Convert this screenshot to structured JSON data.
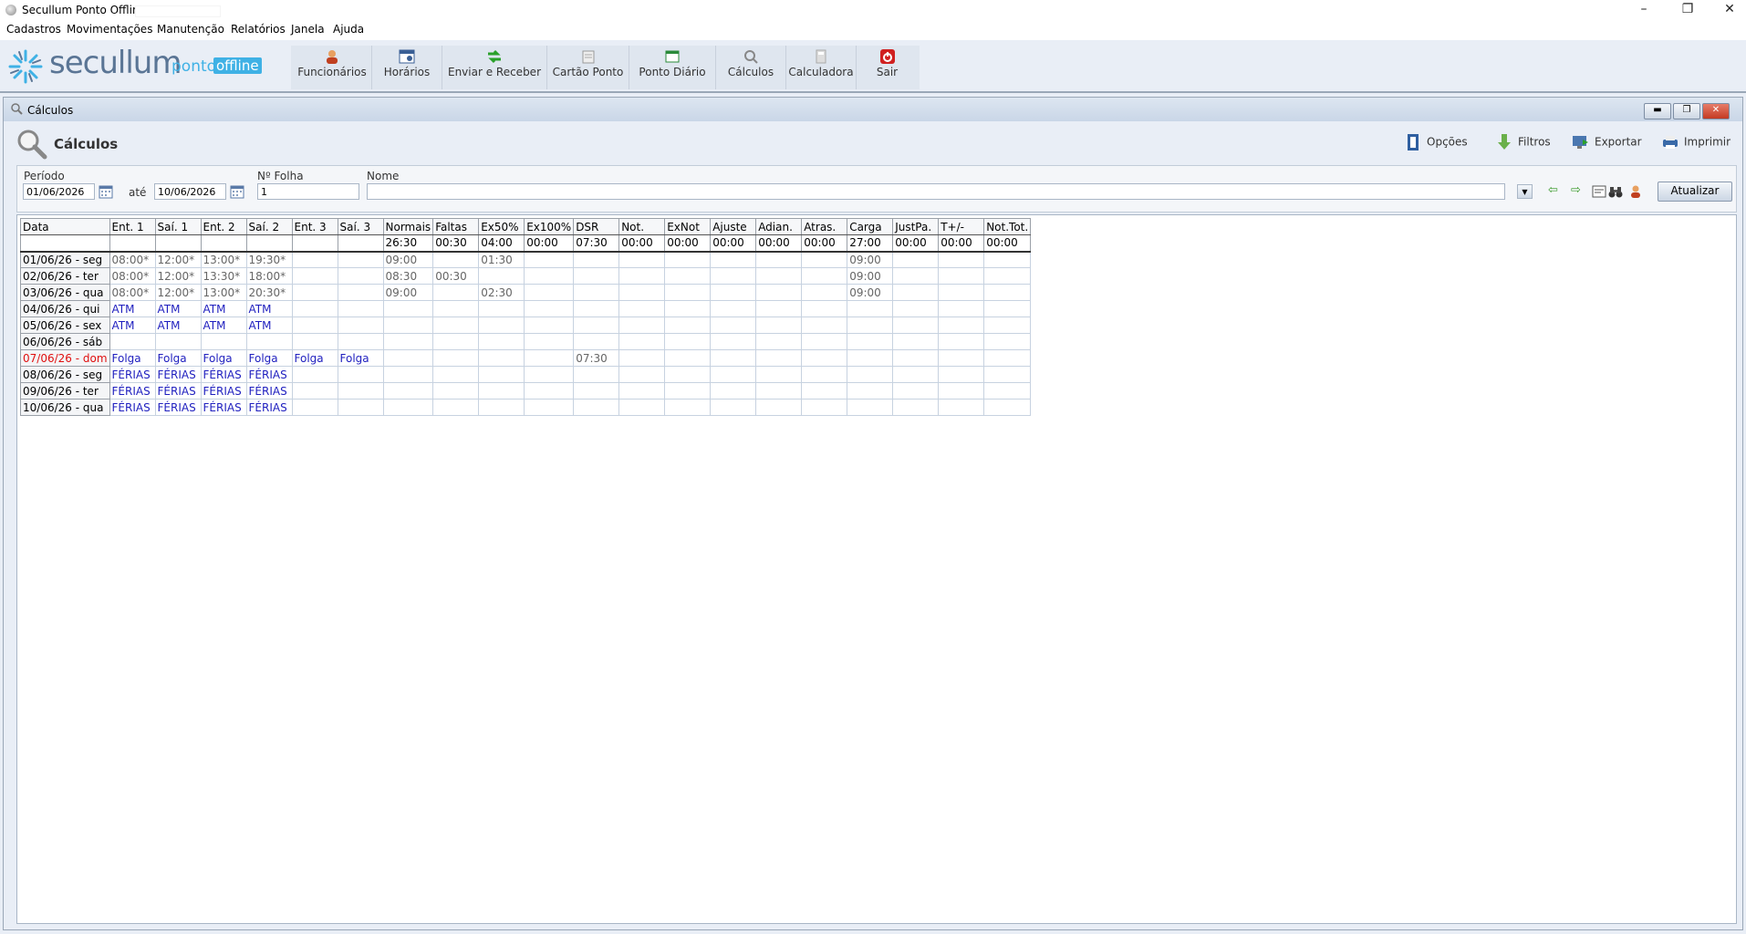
{
  "window": {
    "title": "Secullum Ponto Offline"
  },
  "menu": [
    "Cadastros",
    "Movimentações",
    "Manutenção",
    "Relatórios",
    "Janela",
    "Ajuda"
  ],
  "logo": {
    "word": "secullum",
    "ponto": "ponto",
    "offline": "offline"
  },
  "toolbar": [
    {
      "label": "Funcionários",
      "icon": "employee-icon"
    },
    {
      "label": "Horários",
      "icon": "schedule-icon"
    },
    {
      "label": "Enviar e Receber",
      "icon": "send-receive-icon"
    },
    {
      "label": "Cartão Ponto",
      "icon": "timecard-icon"
    },
    {
      "label": "Ponto Diário",
      "icon": "daily-icon"
    },
    {
      "label": "Cálculos",
      "icon": "calculations-icon"
    },
    {
      "label": "Calculadora",
      "icon": "calculator-icon"
    },
    {
      "label": "Sair",
      "icon": "exit-icon"
    }
  ],
  "inner": {
    "title": "Cálculos",
    "header": "Cálculos"
  },
  "actions": {
    "options": "Opções",
    "filters": "Filtros",
    "export": "Exportar",
    "print": "Imprimir"
  },
  "filter": {
    "period_label": "Período",
    "from": "01/06/2026",
    "until_label": "até",
    "to": "10/06/2026",
    "sheet_label": "Nº Folha",
    "sheet": "1",
    "name_label": "Nome",
    "name": "",
    "refresh": "Atualizar"
  },
  "grid": {
    "columns": [
      "Data",
      "Ent. 1",
      "Saí. 1",
      "Ent. 2",
      "Saí. 2",
      "Ent. 3",
      "Saí. 3",
      "Normais",
      "Faltas",
      "Ex50%",
      "Ex100%",
      "DSR",
      "Not.",
      "ExNot",
      "Ajuste",
      "Adian.",
      "Atras.",
      "Carga",
      "JustPa.",
      "T+/-",
      "Not.Tot."
    ],
    "totals": [
      "",
      "",
      "",
      "",
      "",
      "",
      "",
      "26:30",
      "00:30",
      "04:00",
      "00:00",
      "07:30",
      "00:00",
      "00:00",
      "00:00",
      "00:00",
      "00:00",
      "27:00",
      "00:00",
      "00:00",
      "00:00"
    ],
    "rows": [
      {
        "style": "gray",
        "cells": [
          "01/06/26 - seg",
          "08:00*",
          "12:00*",
          "13:00*",
          "19:30*",
          "",
          "",
          "09:00",
          "",
          "01:30",
          "",
          "",
          "",
          "",
          "",
          "",
          "",
          "09:00",
          "",
          "",
          ""
        ]
      },
      {
        "style": "gray",
        "cells": [
          "02/06/26 - ter",
          "08:00*",
          "12:00*",
          "13:30*",
          "18:00*",
          "",
          "",
          "08:30",
          "00:30",
          "",
          "",
          "",
          "",
          "",
          "",
          "",
          "",
          "09:00",
          "",
          "",
          ""
        ]
      },
      {
        "style": "gray",
        "cells": [
          "03/06/26 - qua",
          "08:00*",
          "12:00*",
          "13:00*",
          "20:30*",
          "",
          "",
          "09:00",
          "",
          "02:30",
          "",
          "",
          "",
          "",
          "",
          "",
          "",
          "09:00",
          "",
          "",
          ""
        ]
      },
      {
        "style": "blue",
        "cells": [
          "04/06/26 - qui",
          "ATM",
          "ATM",
          "ATM",
          "ATM",
          "",
          "",
          "",
          "",
          "",
          "",
          "",
          "",
          "",
          "",
          "",
          "",
          "",
          "",
          "",
          ""
        ]
      },
      {
        "style": "blue",
        "cells": [
          "05/06/26 - sex",
          "ATM",
          "ATM",
          "ATM",
          "ATM",
          "",
          "",
          "",
          "",
          "",
          "",
          "",
          "",
          "",
          "",
          "",
          "",
          "",
          "",
          "",
          ""
        ]
      },
      {
        "style": "blue",
        "cells": [
          "06/06/26 - sáb",
          "",
          "",
          "",
          "",
          "",
          "",
          "",
          "",
          "",
          "",
          "",
          "",
          "",
          "",
          "",
          "",
          "",
          "",
          "",
          ""
        ]
      },
      {
        "style": "blue",
        "red_date": true,
        "cells": [
          "07/06/26 - dom",
          "Folga",
          "Folga",
          "Folga",
          "Folga",
          "Folga",
          "Folga",
          "",
          "",
          "",
          "",
          "07:30",
          "",
          "",
          "",
          "",
          "",
          "",
          "",
          "",
          ""
        ]
      },
      {
        "style": "blue",
        "cells": [
          "08/06/26 - seg",
          "FÉRIAS",
          "FÉRIAS",
          "FÉRIAS",
          "FÉRIAS",
          "",
          "",
          "",
          "",
          "",
          "",
          "",
          "",
          "",
          "",
          "",
          "",
          "",
          "",
          "",
          ""
        ]
      },
      {
        "style": "blue",
        "cells": [
          "09/06/26 - ter",
          "FÉRIAS",
          "FÉRIAS",
          "FÉRIAS",
          "FÉRIAS",
          "",
          "",
          "",
          "",
          "",
          "",
          "",
          "",
          "",
          "",
          "",
          "",
          "",
          "",
          "",
          ""
        ]
      },
      {
        "style": "blue",
        "cells": [
          "10/06/26 - qua",
          "FÉRIAS",
          "FÉRIAS",
          "FÉRIAS",
          "FÉRIAS",
          "",
          "",
          "",
          "",
          "",
          "",
          "",
          "",
          "",
          "",
          "",
          "",
          "",
          "",
          "",
          ""
        ]
      }
    ]
  }
}
